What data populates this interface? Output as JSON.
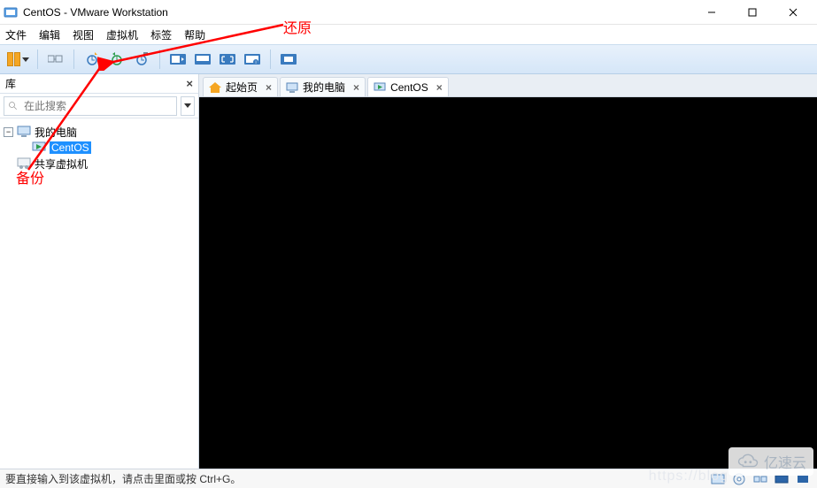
{
  "window": {
    "title": "CentOS - VMware Workstation"
  },
  "menus": {
    "file": "文件",
    "edit": "编辑",
    "view": "视图",
    "vm": "虚拟机",
    "tabs": "标签",
    "help": "帮助"
  },
  "sidebar": {
    "title": "库",
    "search_placeholder": "在此搜索",
    "tree": {
      "my_computer": "我的电脑",
      "centos": "CentOS",
      "shared_vms": "共享虚拟机"
    }
  },
  "tabs": {
    "home": "起始页",
    "my_computer": "我的电脑",
    "centos": "CentOS"
  },
  "status": {
    "text": "要直接输入到该虚拟机，请点击里面或按 Ctrl+G。"
  },
  "annotations": {
    "restore": "还原",
    "backup": "备份"
  },
  "watermark": {
    "text": "亿速云"
  }
}
